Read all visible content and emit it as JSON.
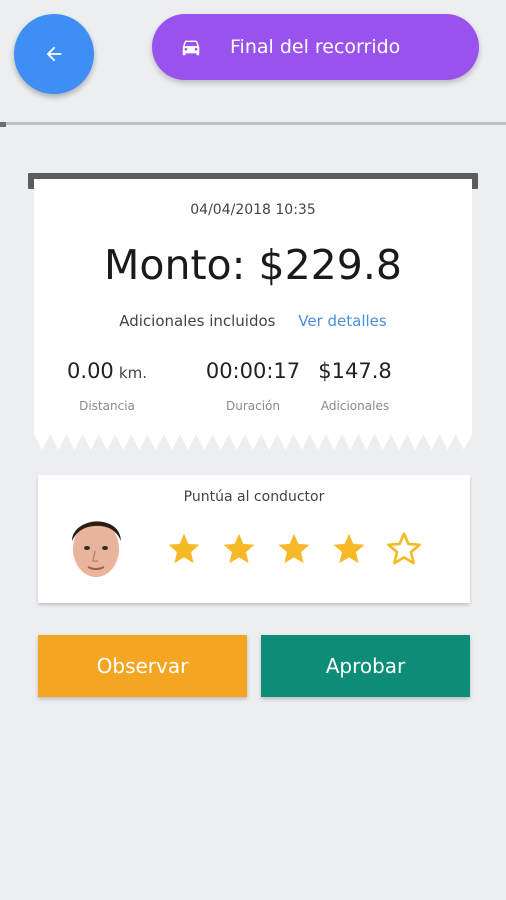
{
  "header": {
    "back_icon": "arrow-left-icon",
    "title": "Final del recorrido",
    "title_icon": "car-icon",
    "title_bg": "#9a52ee",
    "back_bg": "#3f8ef3"
  },
  "receipt": {
    "datetime": "04/04/2018 10:35",
    "amount": "Monto: $229.8",
    "extras_label": "Adicionales incluidos",
    "details_link": "Ver detalles",
    "stats": [
      {
        "value": "0.00",
        "unit": "km.",
        "label": "Distancia"
      },
      {
        "value": "00:00:17",
        "unit": "",
        "label": "Duración"
      },
      {
        "value": "$147.8",
        "unit": "",
        "label": "Adicionales"
      }
    ]
  },
  "rating": {
    "label": "Puntúa al conductor",
    "score": 4,
    "max": 5,
    "star_color": "#f6b928"
  },
  "actions": {
    "observe_label": "Observar",
    "approve_label": "Aprobar",
    "observe_color": "#f4a623",
    "approve_color": "#0d8c78"
  }
}
